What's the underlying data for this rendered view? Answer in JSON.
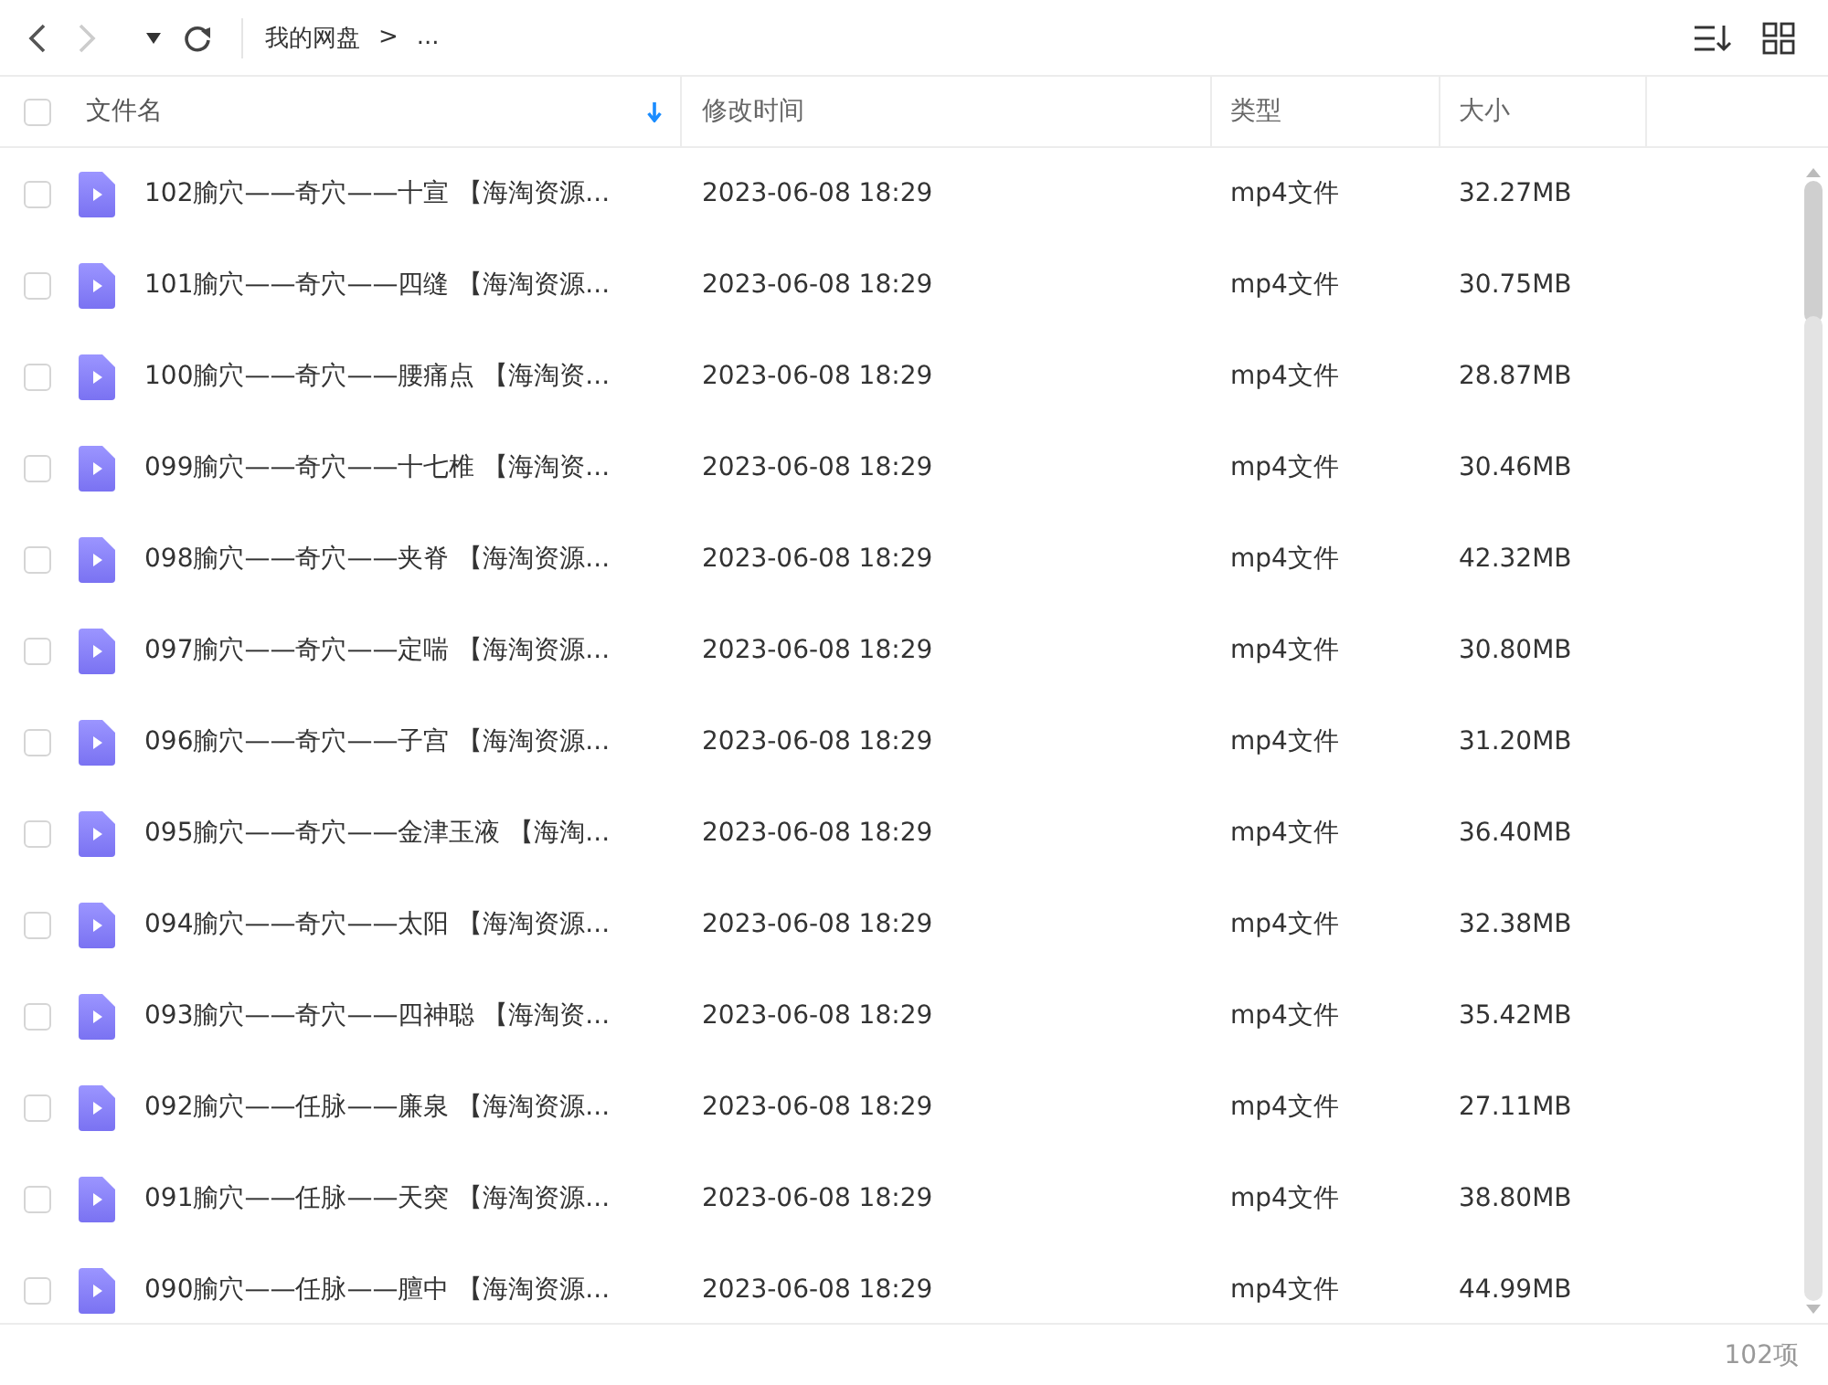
{
  "toolbar": {
    "breadcrumb": [
      {
        "label": "我的网盘"
      },
      {
        "label": "..."
      }
    ],
    "separator": ">"
  },
  "table": {
    "select_all": {
      "checked": false
    },
    "columns": [
      {
        "label": "文件名",
        "sorted": true
      },
      {
        "label": "修改时间",
        "sorted": false
      },
      {
        "label": "类型",
        "sorted": false
      },
      {
        "label": "大小",
        "sorted": false
      }
    ],
    "rows": [
      {
        "checked": false,
        "name": "102腧穴——奇穴——十宣 【海淘资源...",
        "modified": "2023-06-08 18:29",
        "type": "mp4文件",
        "size": "32.27MB"
      },
      {
        "checked": false,
        "name": "101腧穴——奇穴——四缝 【海淘资源...",
        "modified": "2023-06-08 18:29",
        "type": "mp4文件",
        "size": "30.75MB"
      },
      {
        "checked": false,
        "name": "100腧穴——奇穴——腰痛点 【海淘资...",
        "modified": "2023-06-08 18:29",
        "type": "mp4文件",
        "size": "28.87MB"
      },
      {
        "checked": false,
        "name": "099腧穴——奇穴——十七椎 【海淘资...",
        "modified": "2023-06-08 18:29",
        "type": "mp4文件",
        "size": "30.46MB"
      },
      {
        "checked": false,
        "name": "098腧穴——奇穴——夹脊 【海淘资源...",
        "modified": "2023-06-08 18:29",
        "type": "mp4文件",
        "size": "42.32MB"
      },
      {
        "checked": false,
        "name": "097腧穴——奇穴——定喘 【海淘资源...",
        "modified": "2023-06-08 18:29",
        "type": "mp4文件",
        "size": "30.80MB"
      },
      {
        "checked": false,
        "name": "096腧穴——奇穴——子宫 【海淘资源...",
        "modified": "2023-06-08 18:29",
        "type": "mp4文件",
        "size": "31.20MB"
      },
      {
        "checked": false,
        "name": "095腧穴——奇穴——金津玉液 【海淘...",
        "modified": "2023-06-08 18:29",
        "type": "mp4文件",
        "size": "36.40MB"
      },
      {
        "checked": false,
        "name": "094腧穴——奇穴——太阳 【海淘资源...",
        "modified": "2023-06-08 18:29",
        "type": "mp4文件",
        "size": "32.38MB"
      },
      {
        "checked": false,
        "name": "093腧穴——奇穴——四神聪 【海淘资...",
        "modified": "2023-06-08 18:29",
        "type": "mp4文件",
        "size": "35.42MB"
      },
      {
        "checked": false,
        "name": "092腧穴——任脉——廉泉 【海淘资源...",
        "modified": "2023-06-08 18:29",
        "type": "mp4文件",
        "size": "27.11MB"
      },
      {
        "checked": false,
        "name": "091腧穴——任脉——天突 【海淘资源...",
        "modified": "2023-06-08 18:29",
        "type": "mp4文件",
        "size": "38.80MB"
      },
      {
        "checked": false,
        "name": "090腧穴——任脉——膻中 【海淘资源...",
        "modified": "2023-06-08 18:29",
        "type": "mp4文件",
        "size": "44.99MB"
      }
    ]
  },
  "status_bar": {
    "count": "102项"
  }
}
